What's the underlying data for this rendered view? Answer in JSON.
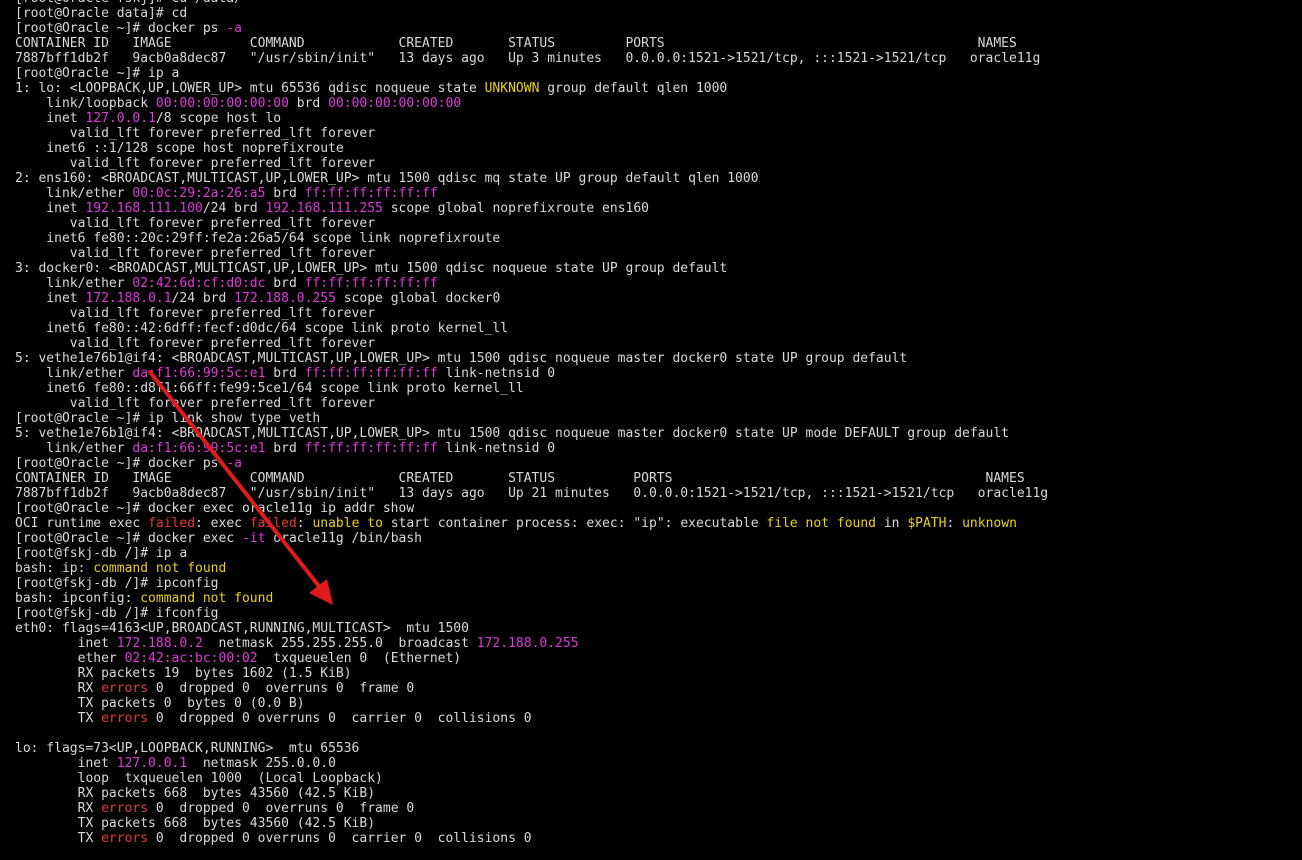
{
  "colors": {
    "background": "#000000",
    "plain": "#d9d9d9",
    "magenta": "#dd3ad8",
    "yellow": "#e8d11f",
    "red": "#e43b3b",
    "arrow": "#e01b1b"
  },
  "annotation": {
    "type": "arrow",
    "icon": "red-arrow-icon"
  },
  "terminal": {
    "lines": [
      {
        "name": "line-cd-data",
        "segs": [
          [
            "[root@Oracle fskj]# cd /data/",
            "plain"
          ]
        ]
      },
      {
        "name": "line-cd",
        "segs": [
          [
            "[root@Oracle data]# cd",
            "plain"
          ]
        ]
      },
      {
        "name": "line-docker-ps-1",
        "segs": [
          [
            "[root@Oracle ~]# docker ps ",
            "plain"
          ],
          [
            "-a",
            "magenta"
          ]
        ]
      },
      {
        "name": "line-ps-header-1",
        "segs": [
          [
            "CONTAINER ID   IMAGE          COMMAND            CREATED       STATUS         PORTS                                        NAMES",
            "plain"
          ]
        ]
      },
      {
        "name": "line-ps-row-1",
        "segs": [
          [
            "7887bff1db2f   9acb0a8dec87   \"/usr/sbin/init\"   13 days ago   Up 3 minutes   0.0.0.0:1521->1521/tcp, :::1521->1521/tcp   oracle11g",
            "plain"
          ]
        ]
      },
      {
        "name": "line-ip-a",
        "segs": [
          [
            "[root@Oracle ~]# ip a",
            "plain"
          ]
        ]
      },
      {
        "name": "line-lo-1",
        "segs": [
          [
            "1: lo: <LOOPBACK,UP,LOWER_UP> mtu 65536 qdisc noqueue state ",
            "plain"
          ],
          [
            "UNKNOWN",
            "yellow"
          ],
          [
            " group default qlen 1000",
            "plain"
          ]
        ]
      },
      {
        "name": "line-lo-link",
        "segs": [
          [
            "    link/loopback ",
            "plain"
          ],
          [
            "00:00:00:00:00:00",
            "magenta"
          ],
          [
            " brd ",
            "plain"
          ],
          [
            "00:00:00:00:00:00",
            "magenta"
          ]
        ]
      },
      {
        "name": "line-lo-inet",
        "segs": [
          [
            "    inet ",
            "plain"
          ],
          [
            "127.0.0.1",
            "magenta"
          ],
          [
            "/8 scope host lo",
            "plain"
          ]
        ]
      },
      {
        "name": "line-lo-valid-1",
        "segs": [
          [
            "       valid_lft forever preferred_lft forever",
            "plain"
          ]
        ]
      },
      {
        "name": "line-lo-inet6",
        "segs": [
          [
            "    inet6 ::1/128 scope host noprefixroute",
            "plain"
          ]
        ]
      },
      {
        "name": "line-lo-valid-2",
        "segs": [
          [
            "       valid_lft forever preferred_lft forever",
            "plain"
          ]
        ]
      },
      {
        "name": "line-ens160",
        "segs": [
          [
            "2: ens160: <BROADCAST,MULTICAST,UP,LOWER_UP> mtu 1500 qdisc mq state UP group default qlen 1000",
            "plain"
          ]
        ]
      },
      {
        "name": "line-ens160-link",
        "segs": [
          [
            "    link/ether ",
            "plain"
          ],
          [
            "00:0c:29:2a:26:a5",
            "magenta"
          ],
          [
            " brd ",
            "plain"
          ],
          [
            "ff:ff:ff:ff:ff:ff",
            "magenta"
          ]
        ]
      },
      {
        "name": "line-ens160-inet",
        "segs": [
          [
            "    inet ",
            "plain"
          ],
          [
            "192.168.111.100",
            "magenta"
          ],
          [
            "/24 brd ",
            "plain"
          ],
          [
            "192.168.111.255",
            "magenta"
          ],
          [
            " scope global noprefixroute ens160",
            "plain"
          ]
        ]
      },
      {
        "name": "line-ens160-valid-1",
        "segs": [
          [
            "       valid_lft forever preferred_lft forever",
            "plain"
          ]
        ]
      },
      {
        "name": "line-ens160-inet6",
        "segs": [
          [
            "    inet6 fe80::20c:29ff:fe2a:26a5/64 scope link noprefixroute",
            "plain"
          ]
        ]
      },
      {
        "name": "line-ens160-valid-2",
        "segs": [
          [
            "       valid_lft forever preferred_lft forever",
            "plain"
          ]
        ]
      },
      {
        "name": "line-docker0",
        "segs": [
          [
            "3: docker0: <BROADCAST,MULTICAST,UP,LOWER_UP> mtu 1500 qdisc noqueue state UP group default",
            "plain"
          ]
        ]
      },
      {
        "name": "line-docker0-link",
        "segs": [
          [
            "    link/ether ",
            "plain"
          ],
          [
            "02:42:6d:cf:d0:dc",
            "magenta"
          ],
          [
            " brd ",
            "plain"
          ],
          [
            "ff:ff:ff:ff:ff:ff",
            "magenta"
          ]
        ]
      },
      {
        "name": "line-docker0-inet",
        "segs": [
          [
            "    inet ",
            "plain"
          ],
          [
            "172.188.0.1",
            "magenta"
          ],
          [
            "/24 brd ",
            "plain"
          ],
          [
            "172.188.0.255",
            "magenta"
          ],
          [
            " scope global docker0",
            "plain"
          ]
        ]
      },
      {
        "name": "line-docker0-valid-1",
        "segs": [
          [
            "       valid_lft forever preferred_lft forever",
            "plain"
          ]
        ]
      },
      {
        "name": "line-docker0-inet6",
        "segs": [
          [
            "    inet6 fe80::42:6dff:fecf:d0dc/64 scope link proto kernel_ll",
            "plain"
          ]
        ]
      },
      {
        "name": "line-docker0-valid-2",
        "segs": [
          [
            "       valid_lft forever preferred_lft forever",
            "plain"
          ]
        ]
      },
      {
        "name": "line-veth",
        "segs": [
          [
            "5: vethe1e76b1@if4: <BROADCAST,MULTICAST,UP,LOWER_UP> mtu 1500 qdisc noqueue master docker0 state UP group default",
            "plain"
          ]
        ]
      },
      {
        "name": "line-veth-link",
        "segs": [
          [
            "    link/ether ",
            "plain"
          ],
          [
            "da:f1:66:99:5c:e1",
            "magenta"
          ],
          [
            " brd ",
            "plain"
          ],
          [
            "ff:ff:ff:ff:ff:ff",
            "magenta"
          ],
          [
            " link-netnsid 0",
            "plain"
          ]
        ]
      },
      {
        "name": "line-veth-inet6",
        "segs": [
          [
            "    inet6 fe80::d8f1:66ff:fe99:5ce1/64 scope link proto kernel_ll",
            "plain"
          ]
        ]
      },
      {
        "name": "line-veth-valid",
        "segs": [
          [
            "       valid_lft forever preferred_lft forever",
            "plain"
          ]
        ]
      },
      {
        "name": "line-ip-link-show",
        "segs": [
          [
            "[root@Oracle ~]# ip link show type veth",
            "plain"
          ]
        ]
      },
      {
        "name": "line-veth-2",
        "segs": [
          [
            "5: vethe1e76b1@if4: <BROADCAST,MULTICAST,UP,LOWER_UP> mtu 1500 qdisc noqueue master docker0 state UP mode DEFAULT group default",
            "plain"
          ]
        ]
      },
      {
        "name": "line-veth-2-link",
        "segs": [
          [
            "    link/ether ",
            "plain"
          ],
          [
            "da:f1:66:99:5c:e1",
            "magenta"
          ],
          [
            " brd ",
            "plain"
          ],
          [
            "ff:ff:ff:ff:ff:ff",
            "magenta"
          ],
          [
            " link-netnsid 0",
            "plain"
          ]
        ]
      },
      {
        "name": "line-docker-ps-2",
        "segs": [
          [
            "[root@Oracle ~]# docker ps ",
            "plain"
          ],
          [
            "-a",
            "magenta"
          ]
        ]
      },
      {
        "name": "line-ps-header-2",
        "segs": [
          [
            "CONTAINER ID   IMAGE          COMMAND            CREATED       STATUS          PORTS                                        NAMES",
            "plain"
          ]
        ]
      },
      {
        "name": "line-ps-row-2",
        "segs": [
          [
            "7887bff1db2f   9acb0a8dec87   \"/usr/sbin/init\"   13 days ago   Up 21 minutes   0.0.0.0:1521->1521/tcp, :::1521->1521/tcp   oracle11g",
            "plain"
          ]
        ]
      },
      {
        "name": "line-docker-exec-ip",
        "segs": [
          [
            "[root@Oracle ~]# docker exec oracle11g ip addr show",
            "plain"
          ]
        ]
      },
      {
        "name": "line-oci-error",
        "segs": [
          [
            "OCI runtime exec ",
            "plain"
          ],
          [
            "failed",
            "red"
          ],
          [
            ": exec ",
            "plain"
          ],
          [
            "failed",
            "red"
          ],
          [
            ": ",
            "plain"
          ],
          [
            "unable to",
            "yellow"
          ],
          [
            " start container process: exec: \"ip\": executable ",
            "plain"
          ],
          [
            "file not found",
            "yellow"
          ],
          [
            " in ",
            "plain"
          ],
          [
            "$PATH",
            "yellow"
          ],
          [
            ": ",
            "plain"
          ],
          [
            "unknown",
            "yellow"
          ]
        ]
      },
      {
        "name": "line-docker-exec-bash",
        "segs": [
          [
            "[root@Oracle ~]# docker exec ",
            "plain"
          ],
          [
            "-it",
            "magenta"
          ],
          [
            " oracle11g /bin/bash",
            "plain"
          ]
        ]
      },
      {
        "name": "line-container-ip-a",
        "segs": [
          [
            "[root@fskj-db /]# ip a",
            "plain"
          ]
        ]
      },
      {
        "name": "line-ip-not-found",
        "segs": [
          [
            "bash: ip: ",
            "plain"
          ],
          [
            "command not found",
            "yellow"
          ]
        ]
      },
      {
        "name": "line-container-ipconfig",
        "segs": [
          [
            "[root@fskj-db /]# ipconfig",
            "plain"
          ]
        ]
      },
      {
        "name": "line-ipconfig-not-found",
        "segs": [
          [
            "bash: ipconfig: ",
            "plain"
          ],
          [
            "command not found",
            "yellow"
          ]
        ]
      },
      {
        "name": "line-container-ifconfig",
        "segs": [
          [
            "[root@fskj-db /]# ifconfig",
            "plain"
          ]
        ]
      },
      {
        "name": "line-eth0",
        "segs": [
          [
            "eth0: flags=4163<UP,BROADCAST,RUNNING,MULTICAST>  mtu 1500",
            "plain"
          ]
        ]
      },
      {
        "name": "line-eth0-inet",
        "segs": [
          [
            "        inet ",
            "plain"
          ],
          [
            "172.188.0.2",
            "magenta"
          ],
          [
            "  netmask 255.255.255.0  broadcast ",
            "plain"
          ],
          [
            "172.188.0.255",
            "magenta"
          ]
        ]
      },
      {
        "name": "line-eth0-ether",
        "segs": [
          [
            "        ether ",
            "plain"
          ],
          [
            "02:42:ac:bc:00:02",
            "magenta"
          ],
          [
            "  txqueuelen 0  (Ethernet)",
            "plain"
          ]
        ]
      },
      {
        "name": "line-eth0-rx-packets",
        "segs": [
          [
            "        RX packets 19  bytes 1602 (1.5 KiB)",
            "plain"
          ]
        ]
      },
      {
        "name": "line-eth0-rx-errors",
        "segs": [
          [
            "        RX ",
            "plain"
          ],
          [
            "errors",
            "red"
          ],
          [
            " 0  dropped 0  overruns 0  frame 0",
            "plain"
          ]
        ]
      },
      {
        "name": "line-eth0-tx-packets",
        "segs": [
          [
            "        TX packets 0  bytes 0 (0.0 B)",
            "plain"
          ]
        ]
      },
      {
        "name": "line-eth0-tx-errors",
        "segs": [
          [
            "        TX ",
            "plain"
          ],
          [
            "errors",
            "red"
          ],
          [
            " 0  dropped 0 overruns 0  carrier 0  collisions 0",
            "plain"
          ]
        ]
      },
      {
        "name": "line-blank",
        "segs": [
          [
            "",
            "plain"
          ]
        ]
      },
      {
        "name": "line-lo-flags",
        "segs": [
          [
            "lo: flags=73<UP,LOOPBACK,RUNNING>  mtu 65536",
            "plain"
          ]
        ]
      },
      {
        "name": "line-lo2-inet",
        "segs": [
          [
            "        inet ",
            "plain"
          ],
          [
            "127.0.0.1",
            "magenta"
          ],
          [
            "  netmask 255.0.0.0",
            "plain"
          ]
        ]
      },
      {
        "name": "line-lo2-loop",
        "segs": [
          [
            "        loop  txqueuelen 1000  (Local Loopback)",
            "plain"
          ]
        ]
      },
      {
        "name": "line-lo2-rx-packets",
        "segs": [
          [
            "        RX packets 668  bytes 43560 (42.5 KiB)",
            "plain"
          ]
        ]
      },
      {
        "name": "line-lo2-rx-errors",
        "segs": [
          [
            "        RX ",
            "plain"
          ],
          [
            "errors",
            "red"
          ],
          [
            " 0  dropped 0  overruns 0  frame 0",
            "plain"
          ]
        ]
      },
      {
        "name": "line-lo2-tx-packets",
        "segs": [
          [
            "        TX packets 668  bytes 43560 (42.5 KiB)",
            "plain"
          ]
        ]
      },
      {
        "name": "line-lo2-tx-errors",
        "segs": [
          [
            "        TX ",
            "plain"
          ],
          [
            "errors",
            "red"
          ],
          [
            " 0  dropped 0 overruns 0  carrier 0  collisions 0",
            "plain"
          ]
        ]
      }
    ]
  }
}
